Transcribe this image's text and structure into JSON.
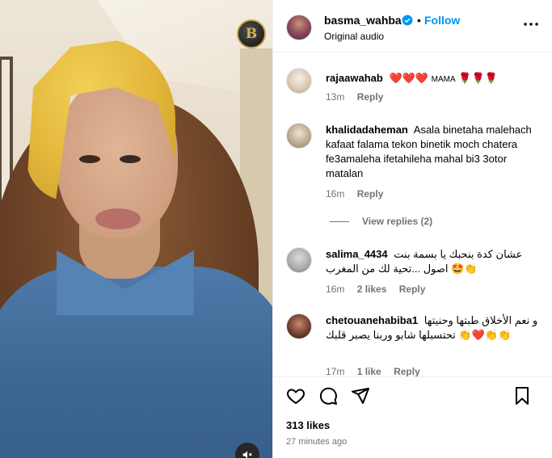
{
  "video": {
    "brand_badge": "B",
    "sound_icon": "speaker-muted-icon"
  },
  "post": {
    "username": "basma_wahba",
    "separator": "•",
    "follow_label": "Follow",
    "audio_label": "Original audio",
    "more_icon": "more-options-icon"
  },
  "comments": [
    {
      "username": "rajaawahab",
      "text_parts": [
        "❤️❤️❤️",
        "MAMA",
        "🌹🌹🌹"
      ],
      "time": "13m",
      "likes": "",
      "reply_label": "Reply"
    },
    {
      "username": "khalidadaheman",
      "text": "Asala binetaha malehach kafaat falama tekon binetik moch chatera fe3amaleha ifetahileha mahal bi3 3otor matalan",
      "time": "16m",
      "likes": "",
      "reply_label": "Reply",
      "view_replies": "View replies (2)"
    },
    {
      "username": "salima_4434",
      "text": "عشان كدة بنحبك يا بسمة بنت اصول ...تحية لك من المغرب",
      "emoji_tail": "🤩👏",
      "time": "16m",
      "likes": "2 likes",
      "reply_label": "Reply"
    },
    {
      "username": "chetouanehabiba1",
      "text": "و نعم الأخلاق طبتها وحنيتها تحتسبلها شابو وربنا يصبر قلبك",
      "emoji_tail": "👏❤️👏👏",
      "time": "17m",
      "likes": "1 like",
      "reply_label": "Reply"
    }
  ],
  "actions": {
    "like_icon": "heart-icon",
    "comment_icon": "comment-icon",
    "share_icon": "share-icon",
    "save_icon": "bookmark-icon",
    "likes_count": "313 likes",
    "timestamp": "27 minutes ago"
  }
}
